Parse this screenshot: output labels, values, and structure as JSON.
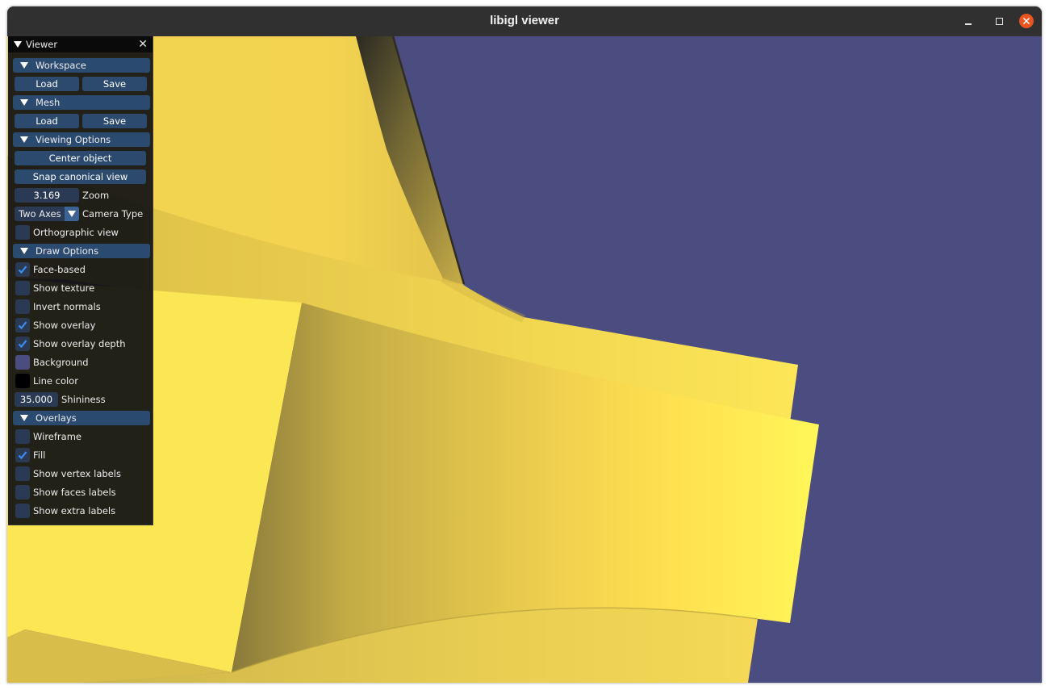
{
  "window": {
    "title": "libigl viewer"
  },
  "colors": {
    "background": "#4b4c80",
    "mesh": "#f4d64d",
    "line_color": "#000000",
    "header": "#2b4a70",
    "button": "#2c4a6e",
    "check": "#3d8ef0"
  },
  "panel": {
    "title": "Viewer",
    "workspace": {
      "header": "Workspace",
      "load": "Load",
      "save": "Save"
    },
    "mesh": {
      "header": "Mesh",
      "load": "Load",
      "save": "Save"
    },
    "viewing": {
      "header": "Viewing Options",
      "center_object": "Center object",
      "snap_view": "Snap canonical view",
      "zoom_value": "3.169",
      "zoom_label": "Zoom",
      "camera_value": "Two Axes",
      "camera_label": "Camera Type",
      "orthographic": {
        "label": "Orthographic view",
        "checked": false
      }
    },
    "draw": {
      "header": "Draw Options",
      "face_based": {
        "label": "Face-based",
        "checked": true
      },
      "show_texture": {
        "label": "Show texture",
        "checked": false
      },
      "invert_normals": {
        "label": "Invert normals",
        "checked": false
      },
      "show_overlay": {
        "label": "Show overlay",
        "checked": true
      },
      "show_overlay_depth": {
        "label": "Show overlay depth",
        "checked": true
      },
      "background_label": "Background",
      "line_color_label": "Line color",
      "shininess_value": "35.000",
      "shininess_label": "Shininess"
    },
    "overlays": {
      "header": "Overlays",
      "wireframe": {
        "label": "Wireframe",
        "checked": false
      },
      "fill": {
        "label": "Fill",
        "checked": true
      },
      "vertex_labels": {
        "label": "Show vertex labels",
        "checked": false
      },
      "faces_labels": {
        "label": "Show faces labels",
        "checked": false
      },
      "extra_labels": {
        "label": "Show extra labels",
        "checked": false
      }
    }
  }
}
